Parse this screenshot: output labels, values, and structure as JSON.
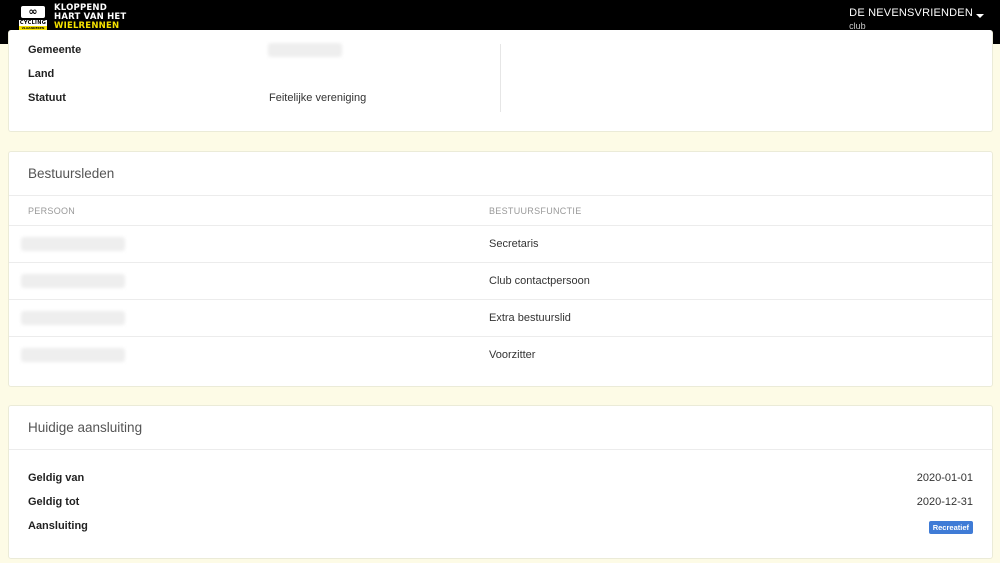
{
  "brand": {
    "line1": "KLOPPEND",
    "line2": "HART VAN HET",
    "line3": "WIELRENNEN",
    "badge_symbol": "∞",
    "badge_cycling": "CYCLING",
    "badge_vlaanderen": "VLAANDEREN"
  },
  "user": {
    "name": "DE NEVENSVRIENDEN",
    "role": "club"
  },
  "club_info": {
    "rows": [
      {
        "label": "Gemeente",
        "value": ""
      },
      {
        "label": "Land",
        "value": ""
      },
      {
        "label": "Statuut",
        "value": "Feitelijke vereniging"
      }
    ]
  },
  "board": {
    "title": "Bestuursleden",
    "columns": [
      "PERSOON",
      "BESTUURSFUNCTIE"
    ],
    "rows": [
      {
        "function": "Secretaris"
      },
      {
        "function": "Club contactpersoon"
      },
      {
        "function": "Extra bestuurslid"
      },
      {
        "function": "Voorzitter"
      }
    ]
  },
  "affiliation": {
    "title": "Huidige aansluiting",
    "rows": [
      {
        "label": "Geldig van",
        "value": "2020-01-01"
      },
      {
        "label": "Geldig tot",
        "value": "2020-12-31"
      },
      {
        "label": "Aansluiting",
        "value": "Recreatief"
      }
    ],
    "badge_color": "#3f7bd6"
  }
}
